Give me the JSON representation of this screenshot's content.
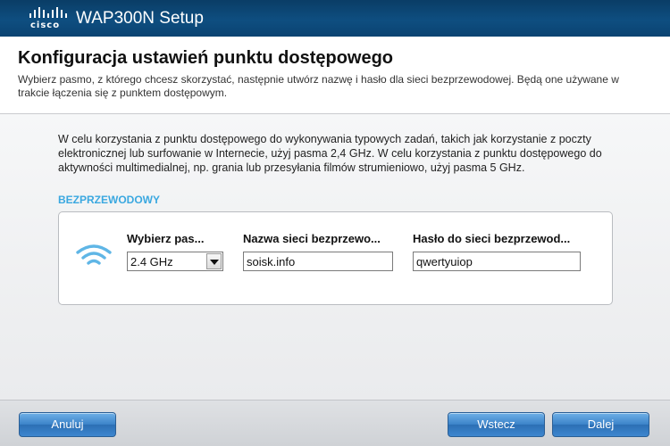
{
  "window": {
    "brand": "cisco",
    "title": "WAP300N Setup"
  },
  "header": {
    "title": "Konfiguracja ustawień punktu dostępowego",
    "subtitle": "Wybierz pasmo, z którego chcesz skorzystać, następnie utwórz nazwę i hasło dla sieci bezprzewodowej. Będą one używane w trakcie łączenia się z punktem dostępowym."
  },
  "main": {
    "description": "W celu korzystania z punktu dostępowego do wykonywania typowych zadań, takich jak korzystanie z poczty elektronicznej lub surfowanie w Internecie, użyj pasma 2,4 GHz. W celu korzystania z punktu dostępowego do aktywności multimedialnej, np. grania lub przesyłania filmów strumieniowo, użyj pasma 5 GHz.",
    "section_label": "BEZPRZEWODOWY",
    "fields": {
      "band_label": "Wybierz pas...",
      "band_value": "2.4 GHz",
      "ssid_label": "Nazwa sieci bezprzewo...",
      "ssid_value": "soisk.info",
      "password_label": "Hasło do sieci bezprzewod...",
      "password_value": "qwertyuiop"
    },
    "icons": {
      "wireless": "wifi-icon",
      "dropdown": "chevron-down-icon"
    }
  },
  "footer": {
    "cancel_label": "Anuluj",
    "back_label": "Wstecz",
    "next_label": "Dalej"
  },
  "colors": {
    "titlebar": "#0e4e80",
    "accent": "#3aa8e0",
    "button": "#3b82c8"
  }
}
